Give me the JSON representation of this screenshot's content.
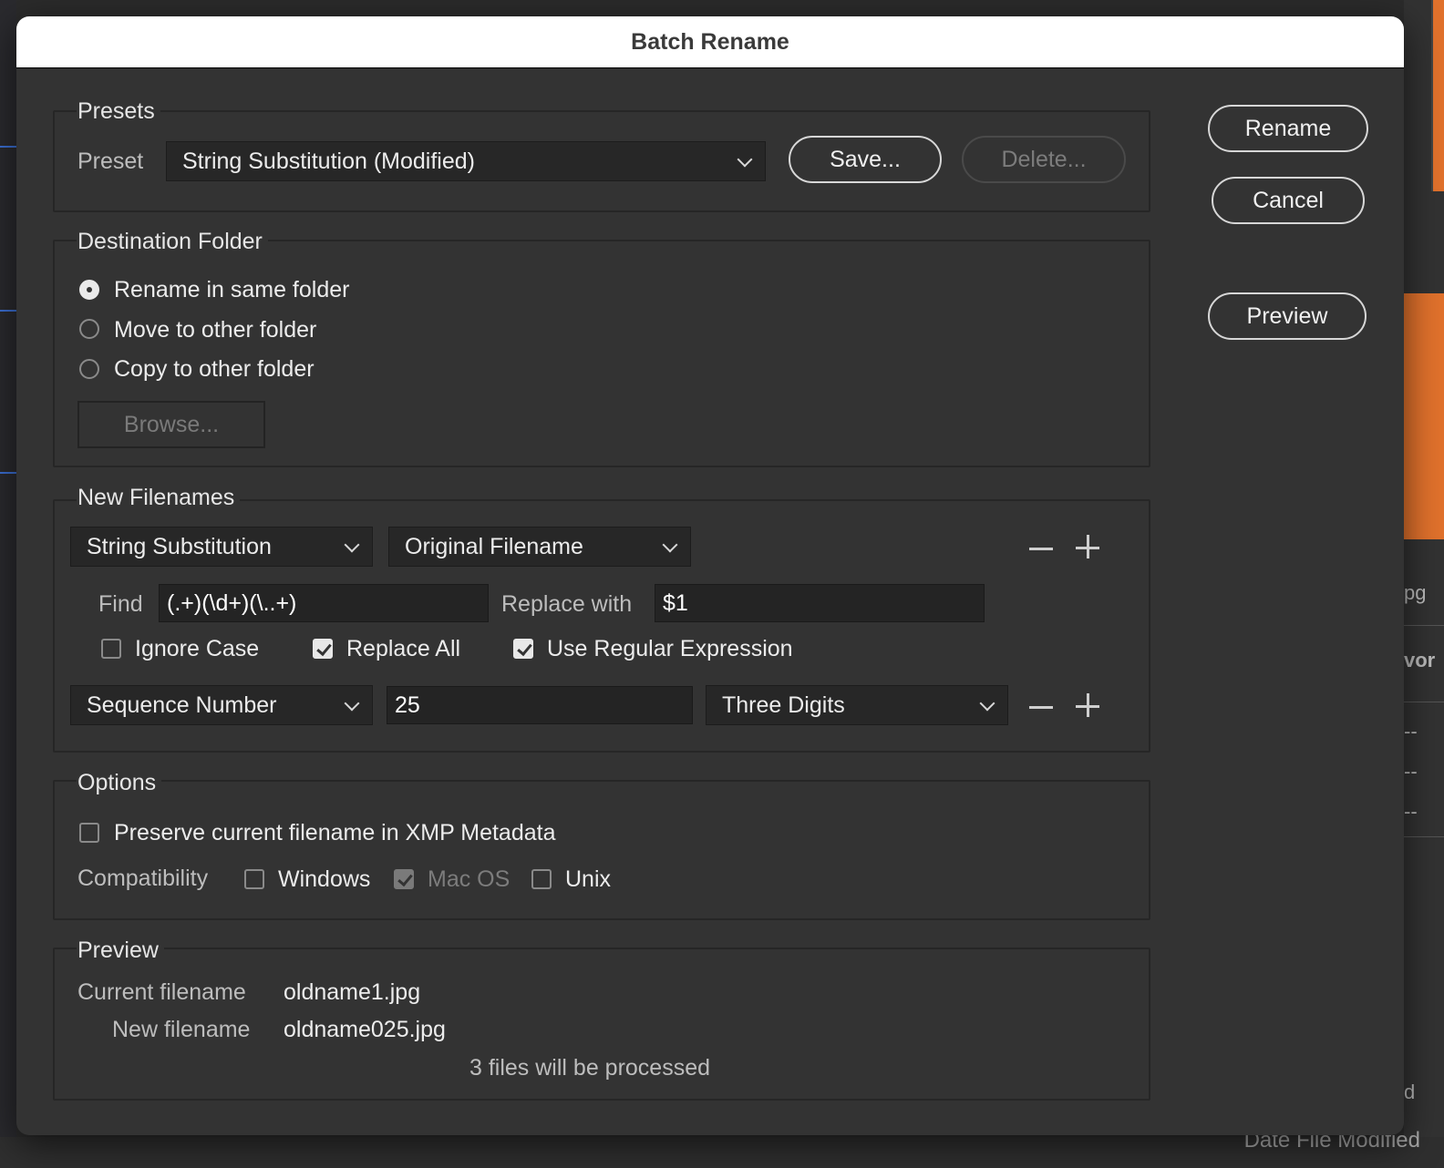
{
  "dialog_title": "Batch Rename",
  "buttons": {
    "rename": "Rename",
    "cancel": "Cancel",
    "preview": "Preview"
  },
  "presets": {
    "title": "Presets",
    "preset_label": "Preset",
    "preset_value": "String Substitution (Modified)",
    "save": "Save...",
    "delete": "Delete..."
  },
  "destination": {
    "title": "Destination Folder",
    "options": [
      "Rename in same folder",
      "Move to other folder",
      "Copy to other folder"
    ],
    "selected": "Rename in same folder",
    "browse": "Browse..."
  },
  "new_filenames": {
    "title": "New Filenames",
    "row1": {
      "type": "String Substitution",
      "source": "Original Filename",
      "find_label": "Find",
      "find_value": "(.+)(\\d+)(\\..+)",
      "replace_label": "Replace with",
      "replace_value": "$1",
      "ignore_case": "Ignore Case",
      "ignore_case_checked": false,
      "replace_all": "Replace All",
      "replace_all_checked": true,
      "use_regex": "Use Regular Expression",
      "use_regex_checked": true
    },
    "row2": {
      "type": "Sequence Number",
      "value": "25",
      "digits": "Three Digits"
    }
  },
  "options": {
    "title": "Options",
    "preserve": "Preserve current filename in XMP Metadata",
    "preserve_checked": false,
    "compat_label": "Compatibility",
    "windows": "Windows",
    "windows_checked": false,
    "macos": "Mac OS",
    "macos_checked": true,
    "unix": "Unix",
    "unix_checked": false
  },
  "preview": {
    "title": "Preview",
    "current_label": "Current filename",
    "current_value": "oldname1.jpg",
    "new_label": "New filename",
    "new_value": "oldname025.jpg",
    "summary": "3 files will be processed"
  },
  "background": {
    "right_fragments": [
      "pg",
      "vor",
      "--",
      "--",
      "--",
      "d"
    ],
    "bottom_fragment": "Date File Modified",
    "accent_color": "#e0712c"
  }
}
